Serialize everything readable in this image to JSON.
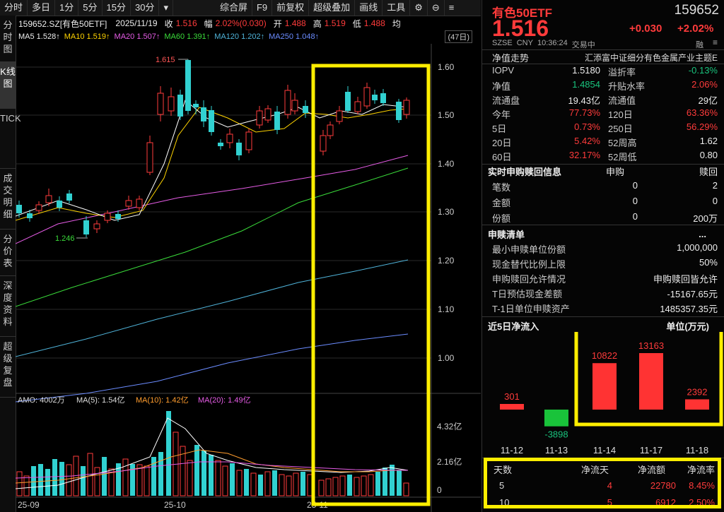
{
  "toolbar": {
    "items": [
      "分时",
      "多日",
      "1分",
      "5分",
      "15分",
      "30分",
      "▾",
      "综合屏",
      "F9",
      "前复权",
      "超级叠加",
      "画线",
      "工具"
    ],
    "settings_icon": "gear-icon",
    "minimize_icon": "minimize-icon",
    "more_icon": "menu-icon"
  },
  "vtabs": [
    "分时图",
    "K线图",
    "TICK",
    "成交明细",
    "分价表",
    "深度资料",
    "超级复盘"
  ],
  "info": {
    "code": "159652.SZ[有色50ETF]",
    "date": "2025/11/19",
    "close_label": "收",
    "close": "1.516",
    "range_label": "幅",
    "range": "2.02%(0.030)",
    "open_label": "开",
    "open": "1.488",
    "high_label": "高",
    "high": "1.519",
    "low_label": "低",
    "low": "1.488",
    "avg_label": "均"
  },
  "ma": {
    "ma5": "MA5 1.528↑",
    "ma10": "MA10 1.519↑",
    "ma20": "MA20 1.507↑",
    "ma60": "MA60 1.391↑",
    "ma120": "MA120 1.202↑",
    "ma250": "MA250 1.048↑",
    "period": "(47日)"
  },
  "price_axis": [
    "1.60",
    "1.50",
    "1.40",
    "1.30",
    "1.20",
    "1.10",
    "1.00"
  ],
  "annotations": {
    "high": "1.615",
    "low": "1.246"
  },
  "vol_info": {
    "amo": "AMO: 4002万",
    "ma5": "MA(5): 1.54亿",
    "ma10": "MA(10): 1.42亿",
    "ma20": "MA(20): 1.49亿"
  },
  "vol_axis": [
    "4.32亿",
    "2.16亿",
    "0"
  ],
  "date_axis": [
    "25-09",
    "25-10",
    "25-11"
  ],
  "header": {
    "name": "有色50ETF",
    "code": "159652",
    "price": "1.516",
    "change": "+0.030",
    "change_pct": "+2.02%",
    "exchange": "SZSE",
    "currency": "CNY",
    "time": "10:36:24",
    "status": "交易中",
    "tag": "融"
  },
  "nav_title": {
    "left": "净值走势",
    "right": "汇添富中证细分有色金属产业主题E"
  },
  "stats": [
    {
      "k1": "IOPV",
      "v1": "1.5180",
      "c1": "white",
      "k2": "溢折率",
      "v2": "-0.13%",
      "c2": "green"
    },
    {
      "k1": "净值",
      "v1": "1.4854",
      "c1": "green",
      "k2": "升贴水率",
      "v2": "2.06%",
      "c2": "red"
    },
    {
      "k1": "流通盘",
      "v1": "19.43亿",
      "c1": "white",
      "k2": "流通值",
      "v2": "29亿",
      "c2": "white"
    },
    {
      "k1": "今年",
      "v1": "77.73%",
      "c1": "red",
      "k2": "120日",
      "v2": "63.36%",
      "c2": "red"
    },
    {
      "k1": "5日",
      "v1": "0.73%",
      "c1": "red",
      "k2": "250日",
      "v2": "56.29%",
      "c2": "red"
    },
    {
      "k1": "20日",
      "v1": "5.42%",
      "c1": "red",
      "k2": "52周高",
      "v2": "1.62",
      "c2": "white"
    },
    {
      "k1": "60日",
      "v1": "32.17%",
      "c1": "red",
      "k2": "52周低",
      "v2": "0.80",
      "c2": "white"
    }
  ],
  "realtime": {
    "title": "实时申购赎回信息",
    "col1": "申购",
    "col2": "赎回",
    "rows": [
      {
        "k": "笔数",
        "a": "0",
        "b": "2"
      },
      {
        "k": "金额",
        "a": "0",
        "b": "0"
      },
      {
        "k": "份额",
        "a": "0",
        "b": "200万"
      }
    ]
  },
  "creation": {
    "title": "申赎清单",
    "more": "...",
    "rows": [
      {
        "k": "最小申赎单位份额",
        "v": "1,000,000"
      },
      {
        "k": "现金替代比例上限",
        "v": "50%"
      },
      {
        "k": "申购赎回允许情况",
        "v": "申购赎回皆允许"
      },
      {
        "k": "T日预估现金差额",
        "v": "-15167.65元"
      },
      {
        "k": "T-1日单位申赎资产",
        "v": "1485357.35元"
      }
    ]
  },
  "inflow": {
    "title": "近5日净流入",
    "unit": "单位(万元)",
    "dates": [
      "11-12",
      "11-13",
      "11-14",
      "11-17",
      "11-18"
    ],
    "values": [
      301,
      -3898,
      10822,
      13163,
      2392
    ],
    "labels": [
      "301",
      "-3898",
      "10822",
      "13163",
      "2392"
    ]
  },
  "summary": {
    "headers": [
      "天数",
      "净流天",
      "净流额",
      "净流率"
    ],
    "rows": [
      {
        "d": "5",
        "n": "4",
        "amt": "22780",
        "rate": "8.45%"
      },
      {
        "d": "10",
        "n": "5",
        "amt": "6912",
        "rate": "2.50%"
      }
    ]
  },
  "colors": {
    "up": "#ff3b3b",
    "down": "#31d1d1",
    "highlight": "#ffee00"
  }
}
